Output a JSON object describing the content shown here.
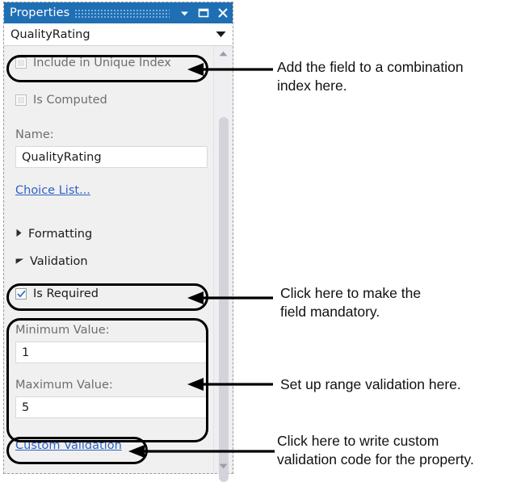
{
  "panel": {
    "title": "Properties",
    "titlebar_buttons": [
      {
        "name": "menu-dropdown",
        "glyph": "chevron-down-icon"
      },
      {
        "name": "maximize",
        "glyph": "maximize-icon"
      },
      {
        "name": "close",
        "glyph": "close-icon"
      }
    ],
    "object_selector": {
      "value": "QualityRating",
      "icon": "chevron-down-icon"
    },
    "rows": {
      "include_in_unique_index": {
        "label": "Include in Unique Index",
        "checked": false,
        "enabled": false
      },
      "is_computed": {
        "label": "Is Computed",
        "checked": false,
        "enabled": false
      },
      "name_label": "Name:",
      "name_value": "QualityRating",
      "choice_list_link": "Choice List...",
      "formatting_group": {
        "label": "Formatting",
        "expanded": false,
        "icon": "triangle-right-icon"
      },
      "validation_group": {
        "label": "Validation",
        "expanded": true,
        "icon": "triangle-down-icon"
      },
      "is_required": {
        "label": "Is Required",
        "checked": true,
        "enabled": true
      },
      "minimum_label": "Minimum Value:",
      "minimum_value": "1",
      "maximum_label": "Maximum Value:",
      "maximum_value": "5",
      "custom_validation_link": "Custom Validation"
    },
    "scrollbar": {
      "up_icon": "triangle-up-icon",
      "down_icon": "triangle-down-icon"
    }
  },
  "annotations": [
    {
      "id": "a1",
      "text": "Add the field to a combination\nindex here."
    },
    {
      "id": "a2",
      "text": "Click here to make the\nfield mandatory."
    },
    {
      "id": "a3",
      "text": "Set up range validation here."
    },
    {
      "id": "a4",
      "text": "Click here to write custom\nvalidation code for the property."
    }
  ],
  "colors": {
    "titlebar_blue": "#1f6fb5",
    "link_blue": "#2f61c4",
    "panel_background": "#f0f0f0",
    "annotation_black": "#000000",
    "checkbox_check_blue": "#2a6fc9"
  }
}
